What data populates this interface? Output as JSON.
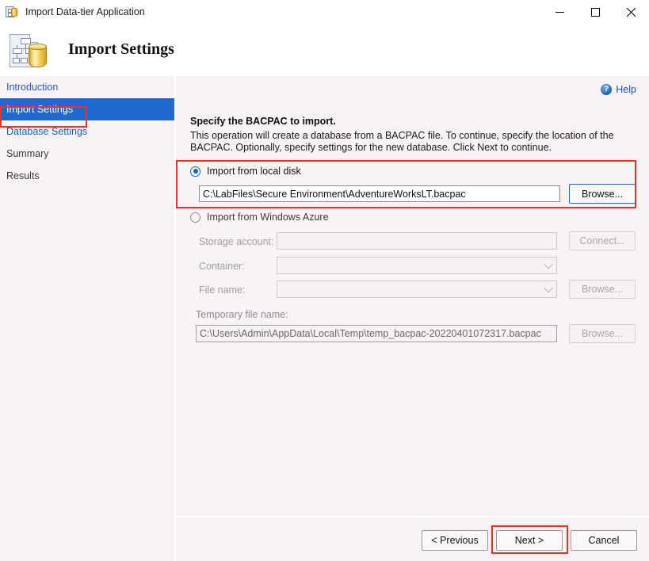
{
  "window": {
    "title": "Import Data-tier Application",
    "icon": "database-application-icon",
    "minimize_label": "–",
    "maximize_label": "□",
    "close_label": "✕"
  },
  "header": {
    "title": "Import Settings",
    "icon": "import-settings-banner-icon"
  },
  "sidebar": {
    "items": [
      {
        "label": "Introduction",
        "state": "link"
      },
      {
        "label": "Import Settings",
        "state": "active"
      },
      {
        "label": "Database Settings",
        "state": "link"
      },
      {
        "label": "Summary",
        "state": "plain"
      },
      {
        "label": "Results",
        "state": "plain"
      }
    ]
  },
  "content": {
    "help": {
      "label": "Help",
      "icon": "help-question-icon"
    },
    "section_title": "Specify the BACPAC to import.",
    "section_body": "This operation will create a database from a BACPAC file. To continue, specify the location of the BACPAC. Optionally, specify settings for the new database. Click Next to continue.",
    "local": {
      "radio_label": "Import from local disk",
      "selected": true,
      "path_value": "C:\\LabFiles\\Secure Environment\\AdventureWorksLT.bacpac",
      "browse_label": "Browse..."
    },
    "azure": {
      "radio_label": "Import from Windows Azure",
      "selected": false,
      "storage_account_label": "Storage account:",
      "storage_account_value": "",
      "connect_label": "Connect...",
      "container_label": "Container:",
      "container_value": "",
      "file_name_label": "File name:",
      "file_name_value": "",
      "file_browse_label": "Browse..."
    },
    "temp": {
      "label": "Temporary file name:",
      "value": "C:\\Users\\Admin\\AppData\\Local\\Temp\\temp_bacpac-20220401072317.bacpac",
      "browse_label": "Browse..."
    }
  },
  "footer": {
    "previous_label": "< Previous",
    "next_label": "Next >",
    "cancel_label": "Cancel"
  },
  "annotations": {
    "highlight_color": "#ee3124",
    "boxes": [
      "sidebar-import-settings",
      "local-disk-group",
      "next-button"
    ]
  }
}
